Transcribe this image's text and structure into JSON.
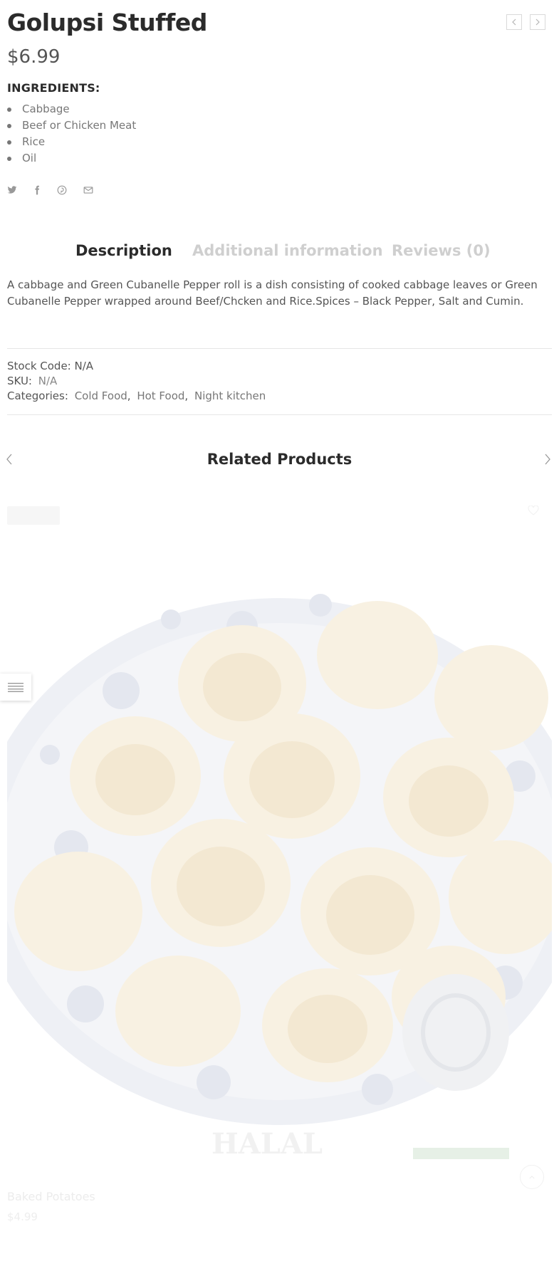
{
  "product": {
    "title": "Golupsi Stuffed",
    "price": "$6.99",
    "ingredients_title": "INGREDIENTS:",
    "ingredients": [
      "Cabbage",
      "Beef or Chicken Meat",
      "Rice",
      "Oil"
    ]
  },
  "nav": {
    "prev_icon": "chevron-left-icon",
    "next_icon": "chevron-right-icon"
  },
  "share": {
    "icons": [
      "twitter-icon",
      "facebook-icon",
      "pinterest-icon",
      "envelope-icon"
    ]
  },
  "tabs": [
    {
      "label": "Description",
      "active": true
    },
    {
      "label": "Additional information",
      "active": false
    },
    {
      "label": "Reviews (0)",
      "active": false
    }
  ],
  "description": "A cabbage and Green Cubanelle Pepper roll is a dish consisting of cooked cabbage leaves or Green Cubanelle Pepper wrapped around Beef/Chcken and Rice.Spices – Black Pepper, Salt and Cumin.",
  "meta": {
    "stock_label": "Stock Code:",
    "stock_value": "N/A",
    "sku_label": "SKU:",
    "sku_value": "N/A",
    "categories_label": "Categories:",
    "categories": [
      "Cold Food",
      "Hot Food",
      "Night kitchen"
    ],
    "separator": ","
  },
  "related": {
    "title": "Related Products",
    "product": {
      "name": "Baked Potatoes",
      "price": "$4.99",
      "image_watermark": "HALAL"
    }
  },
  "colors": {
    "heading": "#2b2b2b",
    "text": "#555555",
    "muted": "#cfcfcf",
    "plate_pattern": "#1f2f6b",
    "food": "#b98a3e"
  }
}
